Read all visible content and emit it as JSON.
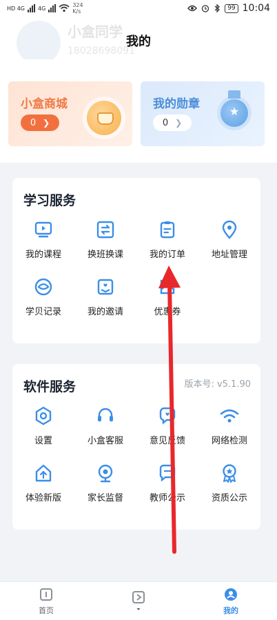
{
  "status_bar": {
    "network_left": "HD 4G",
    "network_right": "4G",
    "speed_value": "324",
    "speed_unit": "K/s",
    "battery": "99",
    "time": "10:04"
  },
  "profile": {
    "name": "小盒同学",
    "user_id": "18028698091"
  },
  "page_title": "我的",
  "cards": {
    "shop": {
      "title": "小盒商城",
      "count": "0"
    },
    "medal": {
      "title": "我的勋章",
      "count": "0"
    }
  },
  "study_section": {
    "title": "学习服务",
    "items": [
      {
        "label": "我的课程",
        "icon": "play-screen-icon"
      },
      {
        "label": "换班换课",
        "icon": "swap-icon"
      },
      {
        "label": "我的订单",
        "icon": "clipboard-icon"
      },
      {
        "label": "地址管理",
        "icon": "location-pin-icon"
      },
      {
        "label": "学贝记录",
        "icon": "shell-coin-icon"
      },
      {
        "label": "我的邀请",
        "icon": "invitation-icon"
      },
      {
        "label": "优惠券",
        "icon": "coupon-icon"
      }
    ]
  },
  "software_section": {
    "title": "软件服务",
    "version": "版本号: v5.1.90",
    "items": [
      {
        "label": "设置",
        "icon": "hexagon-gear-icon"
      },
      {
        "label": "小盒客服",
        "icon": "headset-icon"
      },
      {
        "label": "意见反馈",
        "icon": "feedback-icon"
      },
      {
        "label": "网络检测",
        "icon": "wifi-icon"
      },
      {
        "label": "体验新版",
        "icon": "upgrade-house-icon"
      },
      {
        "label": "家长监督",
        "icon": "webcam-icon"
      },
      {
        "label": "教师公示",
        "icon": "chat-bubble-icon"
      },
      {
        "label": "资质公示",
        "icon": "award-icon"
      }
    ]
  },
  "nav": {
    "home": "首页",
    "mine": "我的"
  },
  "colors": {
    "accent": "#3b8ee8",
    "shop_orange": "#f2703e",
    "annotation_red": "#e8282b"
  }
}
